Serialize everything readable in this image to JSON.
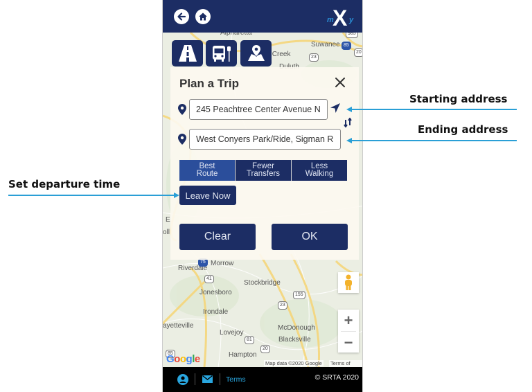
{
  "header": {
    "back_icon": "arrow-left-icon",
    "home_icon": "home-icon",
    "logo_text": "myX"
  },
  "mode_buttons": [
    {
      "name": "express-lanes",
      "icon": "road-icon"
    },
    {
      "name": "transit",
      "icon": "bus-stop-icon"
    },
    {
      "name": "map-locations",
      "icon": "map-pin-icon"
    }
  ],
  "map": {
    "labels": [
      {
        "text": "Alpharetta"
      },
      {
        "text": "Suwanee"
      },
      {
        "text": "s Creek"
      },
      {
        "text": "Duluth"
      },
      {
        "text": "Riverdale"
      },
      {
        "text": "Morrow"
      },
      {
        "text": "Stockbridge"
      },
      {
        "text": "Jonesboro"
      },
      {
        "text": "Irondale"
      },
      {
        "text": "ayetteville"
      },
      {
        "text": "Lovejoy"
      },
      {
        "text": "McDonough"
      },
      {
        "text": "Blacksville"
      },
      {
        "text": "Hampton"
      },
      {
        "text": "E"
      },
      {
        "text": "oll"
      }
    ],
    "shields": [
      "985",
      "85",
      "20",
      "23",
      "75",
      "41",
      "155",
      "23",
      "81",
      "20",
      "85"
    ],
    "google_logo": "Google",
    "attribution": "Map data ©2020 Google",
    "terms_of_use": "Terms of Use",
    "zoom_in": "+",
    "zoom_out": "−"
  },
  "plan_trip": {
    "title": "Plan a Trip",
    "start_address": "245 Peachtree Center Avenue N",
    "end_address": "West Conyers Park/Ride, Sigman R",
    "route_tabs": [
      {
        "line1": "Best",
        "line2": "Route",
        "active": true
      },
      {
        "line1": "Fewer",
        "line2": "Transfers",
        "active": false
      },
      {
        "line1": "Less",
        "line2": "Walking",
        "active": false
      }
    ],
    "departure_label": "Leave Now",
    "clear_label": "Clear",
    "ok_label": "OK"
  },
  "footer": {
    "terms_label": "Terms",
    "copyright": "© SRTA 2020"
  },
  "annotations": {
    "starting_address": "Starting address",
    "ending_address": "Ending address",
    "set_departure_time": "Set departure time"
  },
  "colors": {
    "brand_navy": "#1c2d64",
    "active_tab": "#2b4e9b",
    "accent_blue": "#29a6df",
    "annotation_line": "#2a9fd6"
  }
}
